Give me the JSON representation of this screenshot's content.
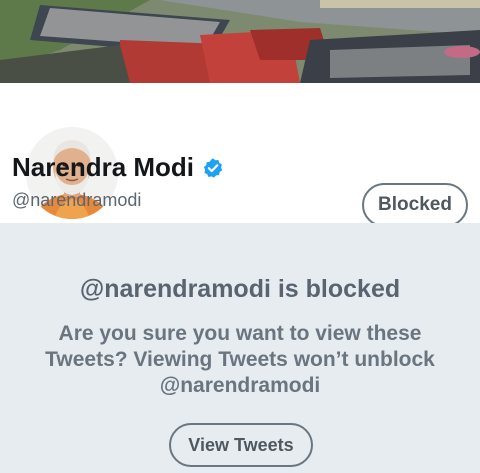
{
  "profile": {
    "name": "Narendra Modi",
    "handle": "@narendramodi",
    "verified": true,
    "blocked_label": "Blocked"
  },
  "notice": {
    "title": "@narendramodi is blocked",
    "body": "Are you sure you want to view these Tweets? Viewing Tweets won’t unblock @narendramodi",
    "view_button_label": "View Tweets"
  },
  "colors": {
    "verified_blue": "#1da1f2",
    "notice_background": "#e6ecf0",
    "button_border": "#6a7680"
  },
  "icons": {
    "verified": "verified-badge-icon"
  }
}
